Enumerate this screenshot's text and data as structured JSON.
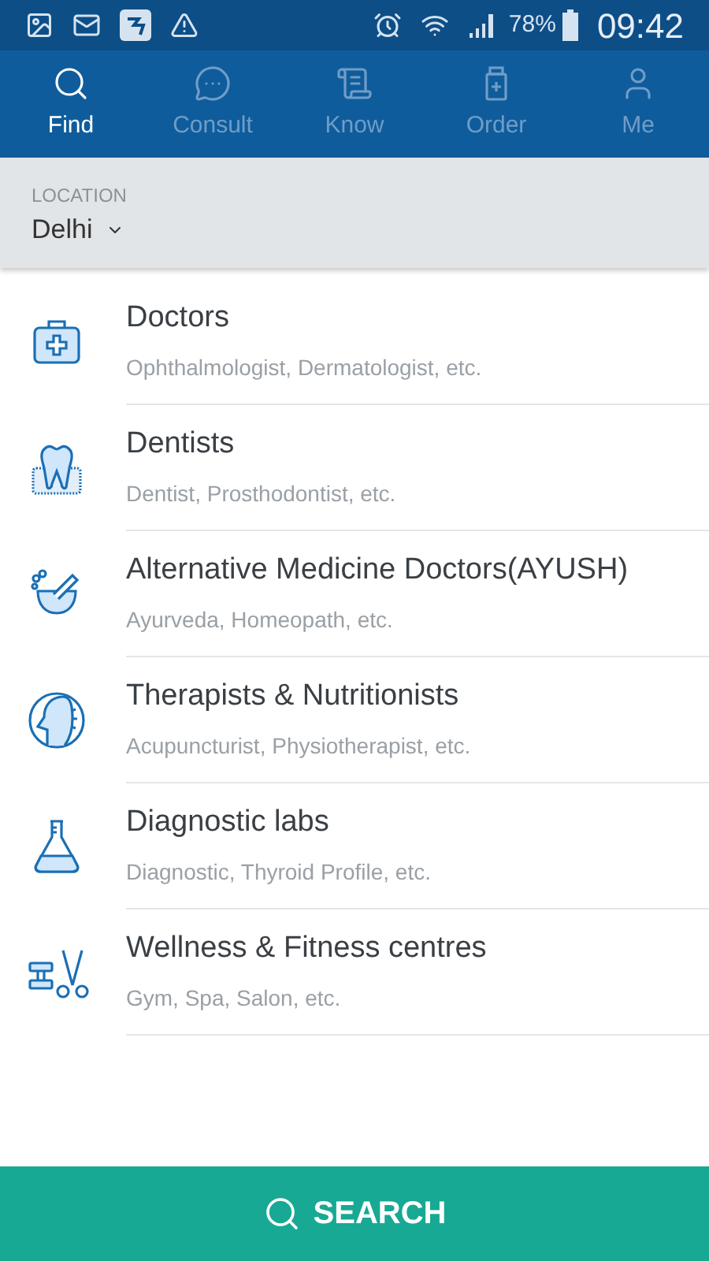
{
  "status_bar": {
    "battery": "78%",
    "time": "09:42"
  },
  "tabs": [
    {
      "label": "Find",
      "kind": "find",
      "selected": true
    },
    {
      "label": "Consult",
      "kind": "consult",
      "selected": false
    },
    {
      "label": "Know",
      "kind": "know",
      "selected": false
    },
    {
      "label": "Order",
      "kind": "order",
      "selected": false
    },
    {
      "label": "Me",
      "kind": "me",
      "selected": false
    }
  ],
  "location": {
    "label": "LOCATION",
    "value": "Delhi"
  },
  "categories": [
    {
      "kind": "doctors",
      "title": "Doctors",
      "subtitle": "Ophthalmologist, Dermatologist, etc."
    },
    {
      "kind": "dentists",
      "title": "Dentists",
      "subtitle": "Dentist, Prosthodontist, etc."
    },
    {
      "kind": "ayush",
      "title": "Alternative Medicine Doctors(AYUSH)",
      "subtitle": "Ayurveda, Homeopath, etc."
    },
    {
      "kind": "therapists",
      "title": "Therapists & Nutritionists",
      "subtitle": "Acupuncturist, Physiotherapist, etc."
    },
    {
      "kind": "labs",
      "title": "Diagnostic labs",
      "subtitle": "Diagnostic, Thyroid Profile, etc."
    },
    {
      "kind": "wellness",
      "title": "Wellness & Fitness centres",
      "subtitle": "Gym, Spa, Salon, etc."
    }
  ],
  "search_button": {
    "label": "SEARCH"
  }
}
